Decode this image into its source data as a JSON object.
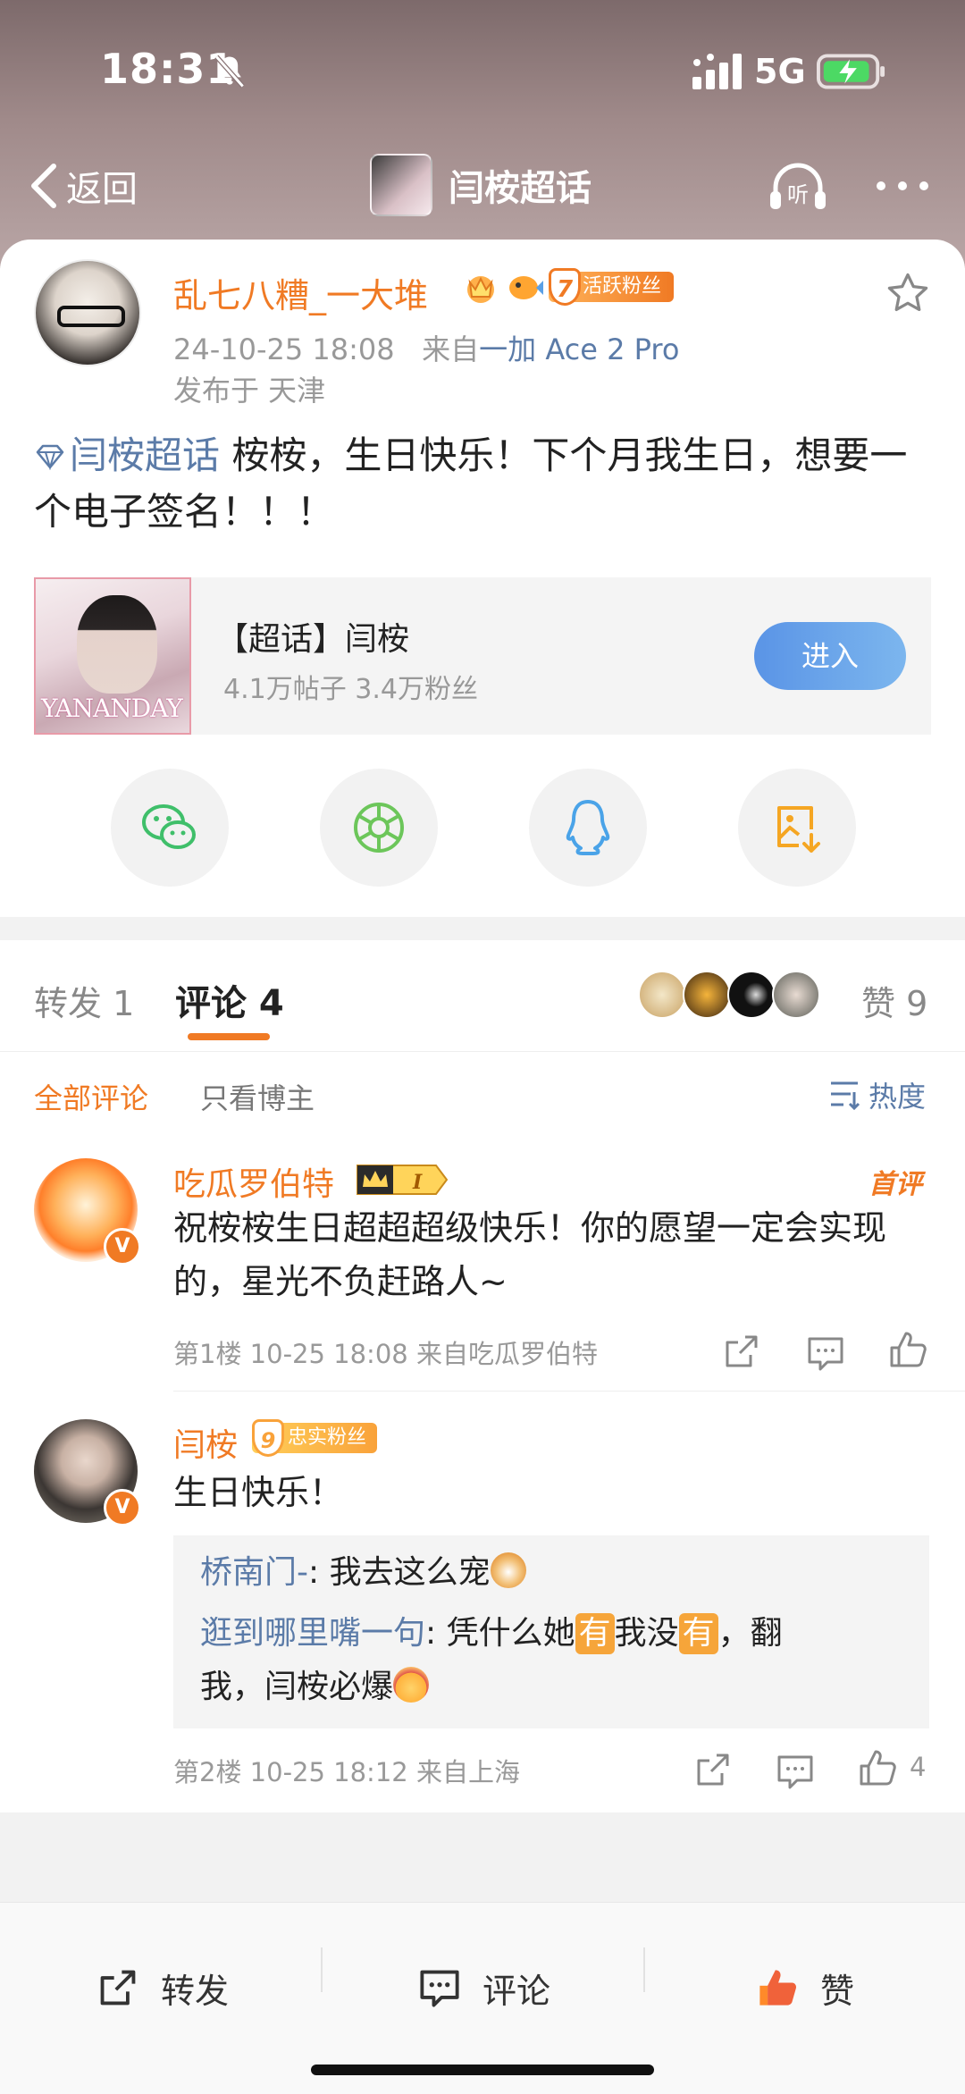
{
  "status_bar": {
    "time": "18:31",
    "network": "5G"
  },
  "nav": {
    "back_label": "返回",
    "title": "闫桉超话"
  },
  "post": {
    "username": "乱七八糟_一大堆",
    "fan_badge_level": "7",
    "fan_badge_label": "活跃粉丝",
    "timestamp": "24-10-25 18:08",
    "source_prefix": "来自",
    "device": "一加 Ace 2 Pro",
    "location": "发布于 天津",
    "topic_link": "闫桉超话",
    "text": " 桉桉，生日快乐！下个月我生日，想要一个电子签名！！！"
  },
  "topic_card": {
    "name": "【超话】闫桉",
    "stats": "4.1万帖子 3.4万粉丝",
    "enter_label": "进入",
    "image_watermark": "YANANDAY"
  },
  "share_buttons": [
    "wechat-icon",
    "moments-icon",
    "qq-icon",
    "save-image-icon"
  ],
  "tabs": {
    "repost": "转发 1",
    "comments": "评论 4",
    "likes": "赞 9"
  },
  "filters": {
    "all": "全部评论",
    "author_only": "只看博主",
    "sort": "热度"
  },
  "comments": [
    {
      "name": "吃瓜罗伯特",
      "tag": "首评",
      "text": "祝桉桉生日超超超级快乐！你的愿望一定会实现的，星光不负赶路人~",
      "meta": "第1楼  10-25 18:08  来自吃瓜罗伯特",
      "likes": ""
    },
    {
      "name": "闫桉",
      "badge_level": "9",
      "badge_label": "忠实粉丝",
      "text": "生日快乐！",
      "meta": "第2楼  10-25 18:12  来自上海",
      "likes": "4",
      "replies": [
        {
          "name": "桥南门-",
          "text_before": ": 我去这么宠"
        },
        {
          "name": "逛到哪里嘴一句",
          "text_a": ": 凭什么她",
          "hl1": "有",
          "text_b": "我没",
          "hl2": "有",
          "text_c": "，翻",
          "text_line2": "我，闫桉必爆"
        }
      ]
    }
  ],
  "bottom_bar": {
    "repost": "转发",
    "comment": "评论",
    "like": "赞"
  },
  "colors": {
    "accent": "#f07a24",
    "link": "#5b7ba8",
    "enter_button": "#5a94e6"
  }
}
